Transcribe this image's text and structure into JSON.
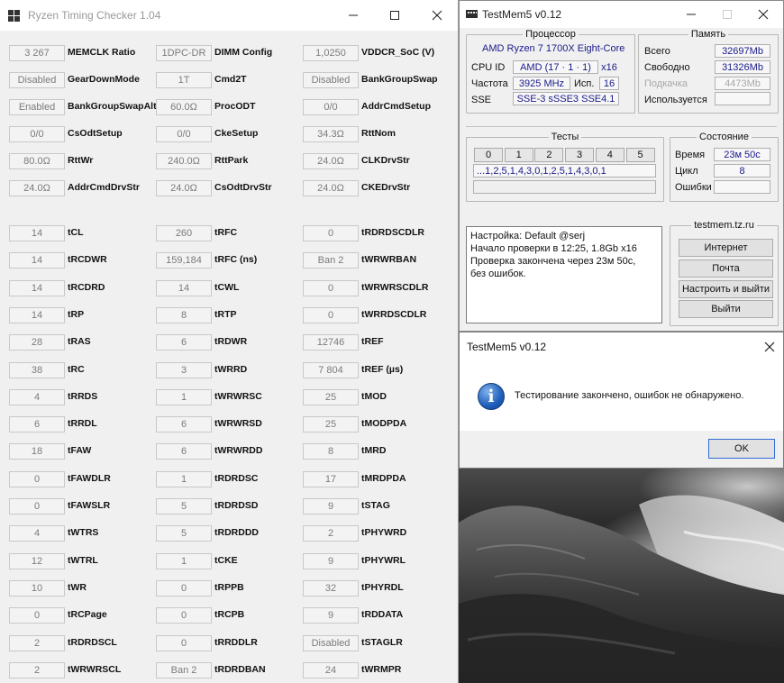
{
  "rtc": {
    "title": "Ryzen Timing Checker 1.04",
    "col1": [
      {
        "v": "3 267",
        "l": "MEMCLK Ratio"
      },
      {
        "v": "Disabled",
        "l": "GearDownMode"
      },
      {
        "v": "Enabled",
        "l": "BankGroupSwapAlt"
      },
      {
        "v": "0/0",
        "l": "CsOdtSetup"
      },
      {
        "v": "80.0Ω",
        "l": "RttWr"
      },
      {
        "v": "24.0Ω",
        "l": "AddrCmdDrvStr"
      },
      {
        "v": "14",
        "l": "tCL"
      },
      {
        "v": "14",
        "l": "tRCDWR"
      },
      {
        "v": "14",
        "l": "tRCDRD"
      },
      {
        "v": "14",
        "l": "tRP"
      },
      {
        "v": "28",
        "l": "tRAS"
      },
      {
        "v": "38",
        "l": "tRC"
      },
      {
        "v": "4",
        "l": "tRRDS"
      },
      {
        "v": "6",
        "l": "tRRDL"
      },
      {
        "v": "18",
        "l": "tFAW"
      },
      {
        "v": "0",
        "l": "tFAWDLR"
      },
      {
        "v": "0",
        "l": "tFAWSLR"
      },
      {
        "v": "4",
        "l": "tWTRS"
      },
      {
        "v": "12",
        "l": "tWTRL"
      },
      {
        "v": "10",
        "l": "tWR"
      },
      {
        "v": "0",
        "l": "tRCPage"
      },
      {
        "v": "2",
        "l": "tRDRDSCL"
      },
      {
        "v": "2",
        "l": "tWRWRSCL"
      }
    ],
    "col2": [
      {
        "v": "1DPC-DR",
        "l": "DIMM Config"
      },
      {
        "v": "1T",
        "l": "Cmd2T"
      },
      {
        "v": "60.0Ω",
        "l": "ProcODT"
      },
      {
        "v": "0/0",
        "l": "CkeSetup"
      },
      {
        "v": "240.0Ω",
        "l": "RttPark"
      },
      {
        "v": "24.0Ω",
        "l": "CsOdtDrvStr"
      },
      {
        "v": "260",
        "l": "tRFC"
      },
      {
        "v": "159,184",
        "l": "tRFC (ns)"
      },
      {
        "v": "14",
        "l": "tCWL"
      },
      {
        "v": "8",
        "l": "tRTP"
      },
      {
        "v": "6",
        "l": "tRDWR"
      },
      {
        "v": "3",
        "l": "tWRRD"
      },
      {
        "v": "1",
        "l": "tWRWRSC"
      },
      {
        "v": "6",
        "l": "tWRWRSD"
      },
      {
        "v": "6",
        "l": "tWRWRDD"
      },
      {
        "v": "1",
        "l": "tRDRDSC"
      },
      {
        "v": "5",
        "l": "tRDRDSD"
      },
      {
        "v": "5",
        "l": "tRDRDDD"
      },
      {
        "v": "1",
        "l": "tCKE"
      },
      {
        "v": "0",
        "l": "tRPPB"
      },
      {
        "v": "0",
        "l": "tRCPB"
      },
      {
        "v": "0",
        "l": "tRRDDLR"
      },
      {
        "v": "Ban 2",
        "l": "tRDRDBAN"
      }
    ],
    "col3": [
      {
        "v": "1,0250",
        "l": "VDDCR_SoC (V)"
      },
      {
        "v": "Disabled",
        "l": "BankGroupSwap"
      },
      {
        "v": "0/0",
        "l": "AddrCmdSetup"
      },
      {
        "v": "34.3Ω",
        "l": "RttNom"
      },
      {
        "v": "24.0Ω",
        "l": "CLKDrvStr"
      },
      {
        "v": "24.0Ω",
        "l": "CKEDrvStr"
      },
      {
        "v": "0",
        "l": "tRDRDSCDLR"
      },
      {
        "v": "Ban 2",
        "l": "tWRWRBAN"
      },
      {
        "v": "0",
        "l": "tWRWRSCDLR"
      },
      {
        "v": "0",
        "l": "tWRRDSCDLR"
      },
      {
        "v": "12746",
        "l": "tREF"
      },
      {
        "v": "7 804",
        "l": "tREF (µs)"
      },
      {
        "v": "25",
        "l": "tMOD"
      },
      {
        "v": "25",
        "l": "tMODPDA"
      },
      {
        "v": "8",
        "l": "tMRD"
      },
      {
        "v": "17",
        "l": "tMRDPDA"
      },
      {
        "v": "9",
        "l": "tSTAG"
      },
      {
        "v": "2",
        "l": "tPHYWRD"
      },
      {
        "v": "9",
        "l": "tPHYWRL"
      },
      {
        "v": "32",
        "l": "tPHYRDL"
      },
      {
        "v": "9",
        "l": "tRDDATA"
      },
      {
        "v": "Disabled",
        "l": "tSTAGLR"
      },
      {
        "v": "24",
        "l": "tWRMPR"
      }
    ]
  },
  "testmem": {
    "title": "TestMem5 v0.12",
    "cpu": {
      "legend": "Процессор",
      "model": "AMD Ryzen 7 1700X Eight-Core",
      "cpuid_label": "CPU ID",
      "cpuid": "AMD  (17 · 1 · 1)",
      "threads": "x16",
      "freq_label": "Частота",
      "freq": "3925 MHz",
      "used_label": "Исп.",
      "used": "16",
      "sse_label": "SSE",
      "sse": "SSE-3 sSSE3 SSE4.1"
    },
    "memory": {
      "legend": "Память",
      "total_label": "Всего",
      "total": "32697Mb",
      "free_label": "Свободно",
      "free": "31326Mb",
      "swap_label": "Подкачка",
      "swap": "4473Mb",
      "used_label": "Используется",
      "used": ""
    },
    "tests": {
      "legend": "Тесты",
      "cells": [
        "0",
        "1",
        "2",
        "3",
        "4",
        "5"
      ],
      "sequence": "...1,2,5,1,4,3,0,1,2,5,1,4,3,0,1"
    },
    "status": {
      "legend": "Состояние",
      "time_label": "Время",
      "time": "23м 50с",
      "cycle_label": "Цикл",
      "cycle": "8",
      "errors_label": "Ошибки",
      "errors": ""
    },
    "log": [
      "Настройка: Default @serj",
      "Начало проверки в 12:25, 1.8Gb x16",
      "Проверка закончена через 23м 50с,",
      "без ошибок."
    ],
    "site": {
      "legend": "testmem.tz.ru",
      "internet": "Интернет",
      "mail": "Почта",
      "configure": "Настроить и выйти",
      "exit": "Выйти"
    }
  },
  "dialog": {
    "title": "TestMem5 v0.12",
    "message": "Тестирование закончено, ошибок не обнаружено.",
    "ok": "OK",
    "icon": "info-icon"
  }
}
